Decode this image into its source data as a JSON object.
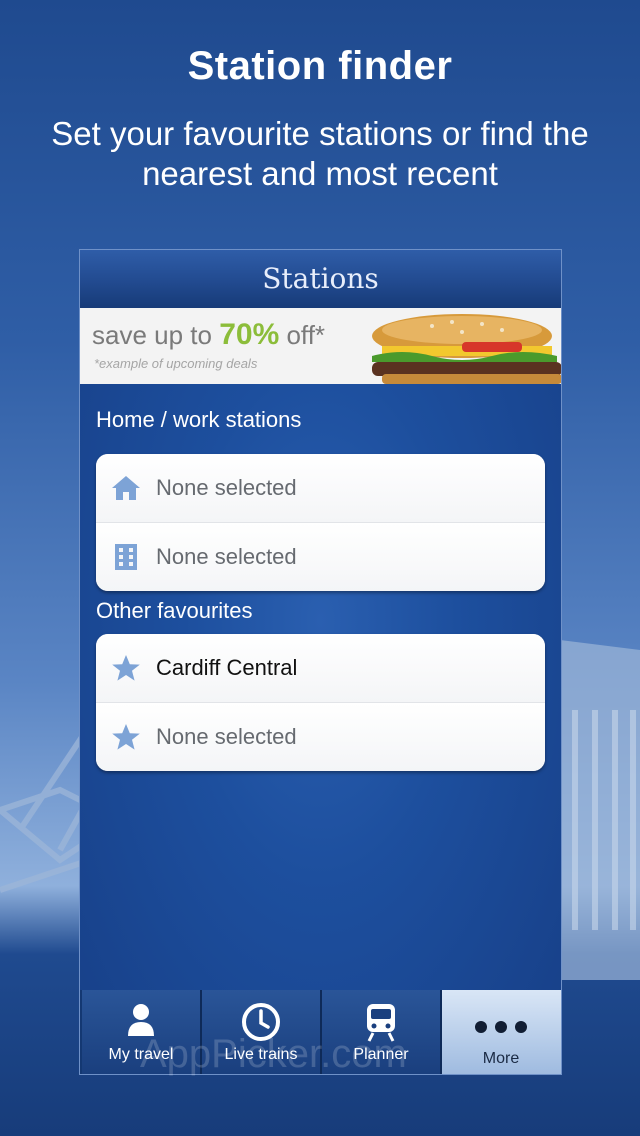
{
  "promo": {
    "title": "Station finder",
    "subtitle": "Set your favourite stations or find the nearest and most recent"
  },
  "screen": {
    "header_title": "Stations",
    "ad": {
      "text_before": "save up to ",
      "percent": "70%",
      "text_after": " off*",
      "note": "*example of upcoming deals"
    },
    "sections": [
      {
        "label": "Home / work stations",
        "rows": [
          {
            "icon": "home-icon",
            "label": "None selected",
            "selected": false
          },
          {
            "icon": "office-building-icon",
            "label": "None selected",
            "selected": false
          }
        ]
      },
      {
        "label": "Other favourites",
        "rows": [
          {
            "icon": "star-icon",
            "label": "Cardiff Central",
            "selected": true
          },
          {
            "icon": "star-icon",
            "label": "None selected",
            "selected": false
          }
        ]
      }
    ],
    "tabs": [
      {
        "icon": "person-icon",
        "label": "My travel",
        "active": false
      },
      {
        "icon": "clock-icon",
        "label": "Live trains",
        "active": false
      },
      {
        "icon": "train-icon",
        "label": "Planner",
        "active": false
      },
      {
        "icon": "more-dots-icon",
        "label": "More",
        "active": true
      }
    ]
  },
  "watermark": "AppPicker.com",
  "colors": {
    "accent_green": "#8cbd3a",
    "icon_blue": "#7da3d6",
    "header_blue": "#234c92"
  }
}
